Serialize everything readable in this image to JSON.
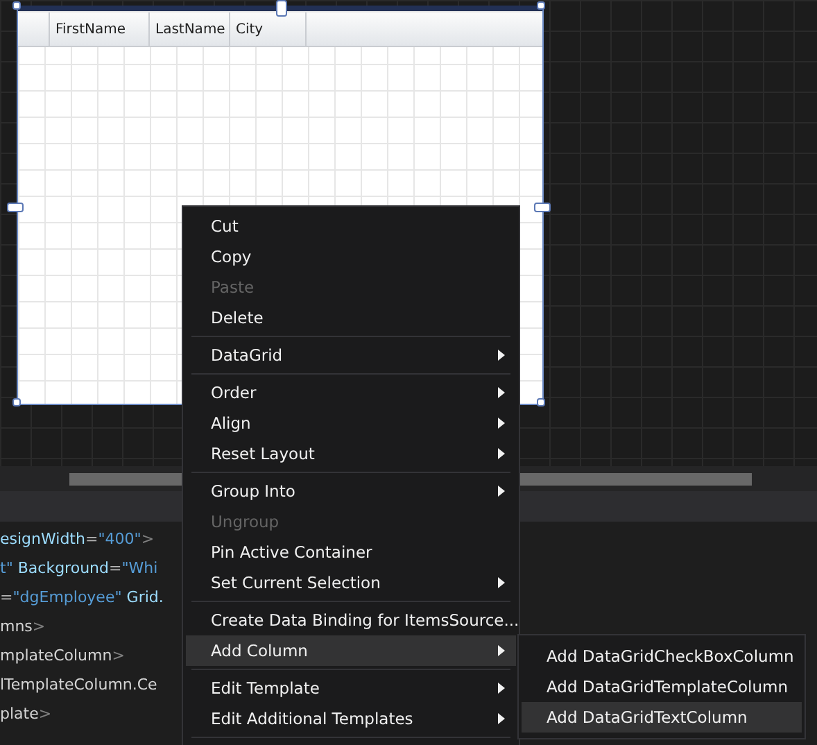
{
  "datagrid": {
    "columns": [
      "FirstName",
      "LastName",
      "City"
    ]
  },
  "code_lines": [
    [
      {
        "kind": "attr",
        "text": "esignWidth"
      },
      {
        "kind": "punct",
        "text": "="
      },
      {
        "kind": "value",
        "text": "\"400\""
      },
      {
        "kind": "tag",
        "text": ">"
      }
    ],
    [
      {
        "kind": "value",
        "text": "t\""
      },
      {
        "kind": "attr",
        "text": " Background"
      },
      {
        "kind": "punct",
        "text": "="
      },
      {
        "kind": "value",
        "text": "\"Whi"
      }
    ],
    [
      {
        "kind": "punct",
        "text": "="
      },
      {
        "kind": "value",
        "text": "\"dgEmployee\""
      },
      {
        "kind": "attr",
        "text": " Grid."
      }
    ],
    [
      {
        "kind": "name",
        "text": "mns"
      },
      {
        "kind": "tag",
        "text": ">"
      }
    ],
    [
      {
        "kind": "name",
        "text": "mplateColumn"
      },
      {
        "kind": "tag",
        "text": ">"
      }
    ],
    [
      {
        "kind": "name",
        "text": "lTemplateColumn.Ce"
      }
    ],
    [
      {
        "kind": "name",
        "text": "plate"
      },
      {
        "kind": "tag",
        "text": ">"
      }
    ]
  ],
  "context_menu": [
    {
      "kind": "item",
      "label": "Cut",
      "disabled": false,
      "submenu": false,
      "selected": false
    },
    {
      "kind": "item",
      "label": "Copy",
      "disabled": false,
      "submenu": false,
      "selected": false
    },
    {
      "kind": "item",
      "label": "Paste",
      "disabled": true,
      "submenu": false,
      "selected": false
    },
    {
      "kind": "item",
      "label": "Delete",
      "disabled": false,
      "submenu": false,
      "selected": false
    },
    {
      "kind": "separator"
    },
    {
      "kind": "item",
      "label": "DataGrid",
      "disabled": false,
      "submenu": true,
      "selected": false
    },
    {
      "kind": "separator"
    },
    {
      "kind": "item",
      "label": "Order",
      "disabled": false,
      "submenu": true,
      "selected": false
    },
    {
      "kind": "item",
      "label": "Align",
      "disabled": false,
      "submenu": true,
      "selected": false
    },
    {
      "kind": "item",
      "label": "Reset Layout",
      "disabled": false,
      "submenu": true,
      "selected": false
    },
    {
      "kind": "separator"
    },
    {
      "kind": "item",
      "label": "Group Into",
      "disabled": false,
      "submenu": true,
      "selected": false
    },
    {
      "kind": "item",
      "label": "Ungroup",
      "disabled": true,
      "submenu": false,
      "selected": false
    },
    {
      "kind": "item",
      "label": "Pin Active Container",
      "disabled": false,
      "submenu": false,
      "selected": false
    },
    {
      "kind": "item",
      "label": "Set Current Selection",
      "disabled": false,
      "submenu": true,
      "selected": false
    },
    {
      "kind": "separator"
    },
    {
      "kind": "item",
      "label": "Create Data Binding for ItemsSource...",
      "disabled": false,
      "submenu": false,
      "selected": false
    },
    {
      "kind": "item",
      "label": "Add Column",
      "disabled": false,
      "submenu": true,
      "selected": true
    },
    {
      "kind": "separator"
    },
    {
      "kind": "item",
      "label": "Edit Template",
      "disabled": false,
      "submenu": true,
      "selected": false
    },
    {
      "kind": "item",
      "label": "Edit Additional Templates",
      "disabled": false,
      "submenu": true,
      "selected": false
    },
    {
      "kind": "separator"
    }
  ],
  "submenu": [
    {
      "label": "Add DataGridCheckBoxColumn",
      "selected": false
    },
    {
      "label": "Add DataGridTemplateColumn",
      "selected": false
    },
    {
      "label": "Add DataGridTextColumn",
      "selected": true
    }
  ]
}
